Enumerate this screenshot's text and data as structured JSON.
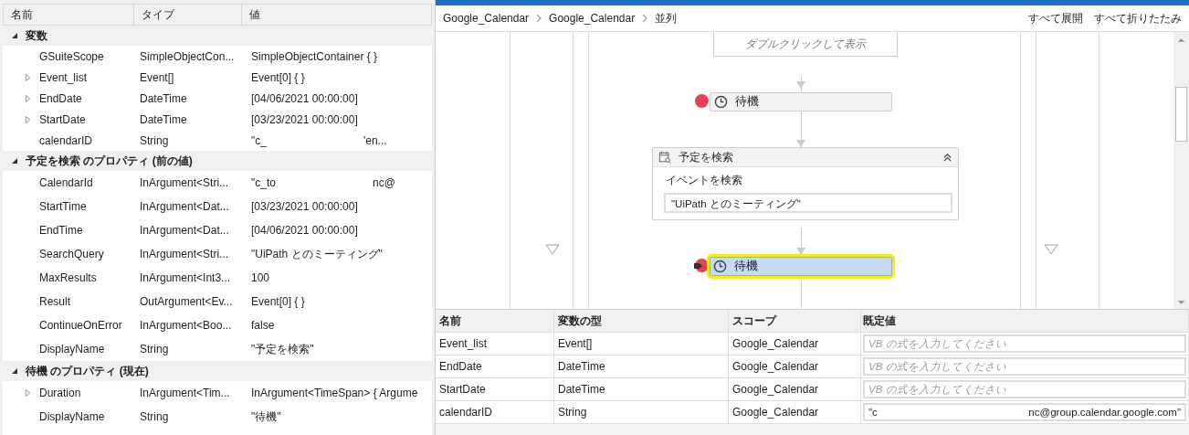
{
  "properties": {
    "columns": [
      "名前",
      "タイプ",
      "値"
    ],
    "sections": [
      {
        "title": "変数",
        "expanded": true,
        "items": [
          {
            "name": "GSuiteScope",
            "type": "SimpleObjectCon...",
            "value": [
              "SimpleObjectContainer { }"
            ],
            "expandable": false
          },
          {
            "name": "Event_list",
            "type": "Event[]",
            "value": [
              "Event[0] { }"
            ],
            "expandable": true
          },
          {
            "name": "EndDate",
            "type": "DateTime",
            "value": [
              "[04/06/2021 00:00:00]"
            ],
            "expandable": true
          },
          {
            "name": "StartDate",
            "type": "DateTime",
            "value": [
              "[03/23/2021 00:00:00]"
            ],
            "expandable": true
          },
          {
            "name": "calendarID",
            "type": "String",
            "value": [
              "\"c_",
              "'en..."
            ],
            "expandable": false
          }
        ]
      },
      {
        "title": "予定を検索 のプロパティ (前の値)",
        "expanded": true,
        "items": [
          {
            "name": "CalendarId",
            "type": "InArgument<Stri...",
            "value": [
              "\"c_to",
              "nc@"
            ],
            "expandable": false
          },
          {
            "name": "StartTime",
            "type": "InArgument<Dat...",
            "value": [
              "[03/23/2021 00:00:00]"
            ],
            "expandable": false
          },
          {
            "name": "EndTime",
            "type": "InArgument<Dat...",
            "value": [
              "[04/06/2021 00:00:00]"
            ],
            "expandable": false
          },
          {
            "name": "SearchQuery",
            "type": "InArgument<Stri...",
            "value": [
              "\"UiPath とのミーティング\""
            ],
            "expandable": false
          },
          {
            "name": "MaxResults",
            "type": "InArgument<Int3...",
            "value": [
              "100"
            ],
            "expandable": false
          },
          {
            "name": "Result",
            "type": "OutArgument<Ev...",
            "value": [
              "Event[0] { }"
            ],
            "expandable": false
          },
          {
            "name": "ContinueOnError",
            "type": "InArgument<Boo...",
            "value": [
              "false"
            ],
            "expandable": false
          },
          {
            "name": "DisplayName",
            "type": "String",
            "value": [
              "\"予定を検索\""
            ],
            "expandable": false
          }
        ]
      },
      {
        "title": "待機 のプロパティ (現在)",
        "expanded": true,
        "items": [
          {
            "name": "Duration",
            "type": "InArgument<Tim...",
            "value": [
              "InArgument<TimeSpan> { Argume"
            ],
            "expandable": true
          },
          {
            "name": "DisplayName",
            "type": "String",
            "value": [
              "\"待機\""
            ],
            "expandable": false
          }
        ]
      }
    ]
  },
  "breadcrumb": [
    "Google_Calendar",
    "Google_Calendar",
    "並列"
  ],
  "toolbar": [
    "すべて展開",
    "すべて折りたたみ"
  ],
  "designer": {
    "collapsed_hint": "ダブルクリックして表示",
    "wait1": {
      "label": "待機",
      "breakpoint": true,
      "selected": false
    },
    "activity": {
      "title": "予定を検索",
      "field_label": "イベントを検索",
      "field_value": "\"UiPath とのミーティング\""
    },
    "wait2": {
      "label": "待機",
      "breakpoint": true,
      "selected": true
    }
  },
  "variables": {
    "columns": [
      "名前",
      "変数の型",
      "スコープ",
      "既定値"
    ],
    "rows": [
      {
        "name": "Event_list",
        "type": "Event[]",
        "scope": "Google_Calendar",
        "default_placeholder": "VB の式を入力してください"
      },
      {
        "name": "EndDate",
        "type": "DateTime",
        "scope": "Google_Calendar",
        "default_placeholder": "VB の式を入力してください"
      },
      {
        "name": "StartDate",
        "type": "DateTime",
        "scope": "Google_Calendar",
        "default_placeholder": "VB の式を入力してください"
      },
      {
        "name": "calendarID",
        "type": "String",
        "scope": "Google_Calendar",
        "default_value": [
          "\"c",
          "nc@group.calendar.google.com\""
        ]
      }
    ]
  }
}
